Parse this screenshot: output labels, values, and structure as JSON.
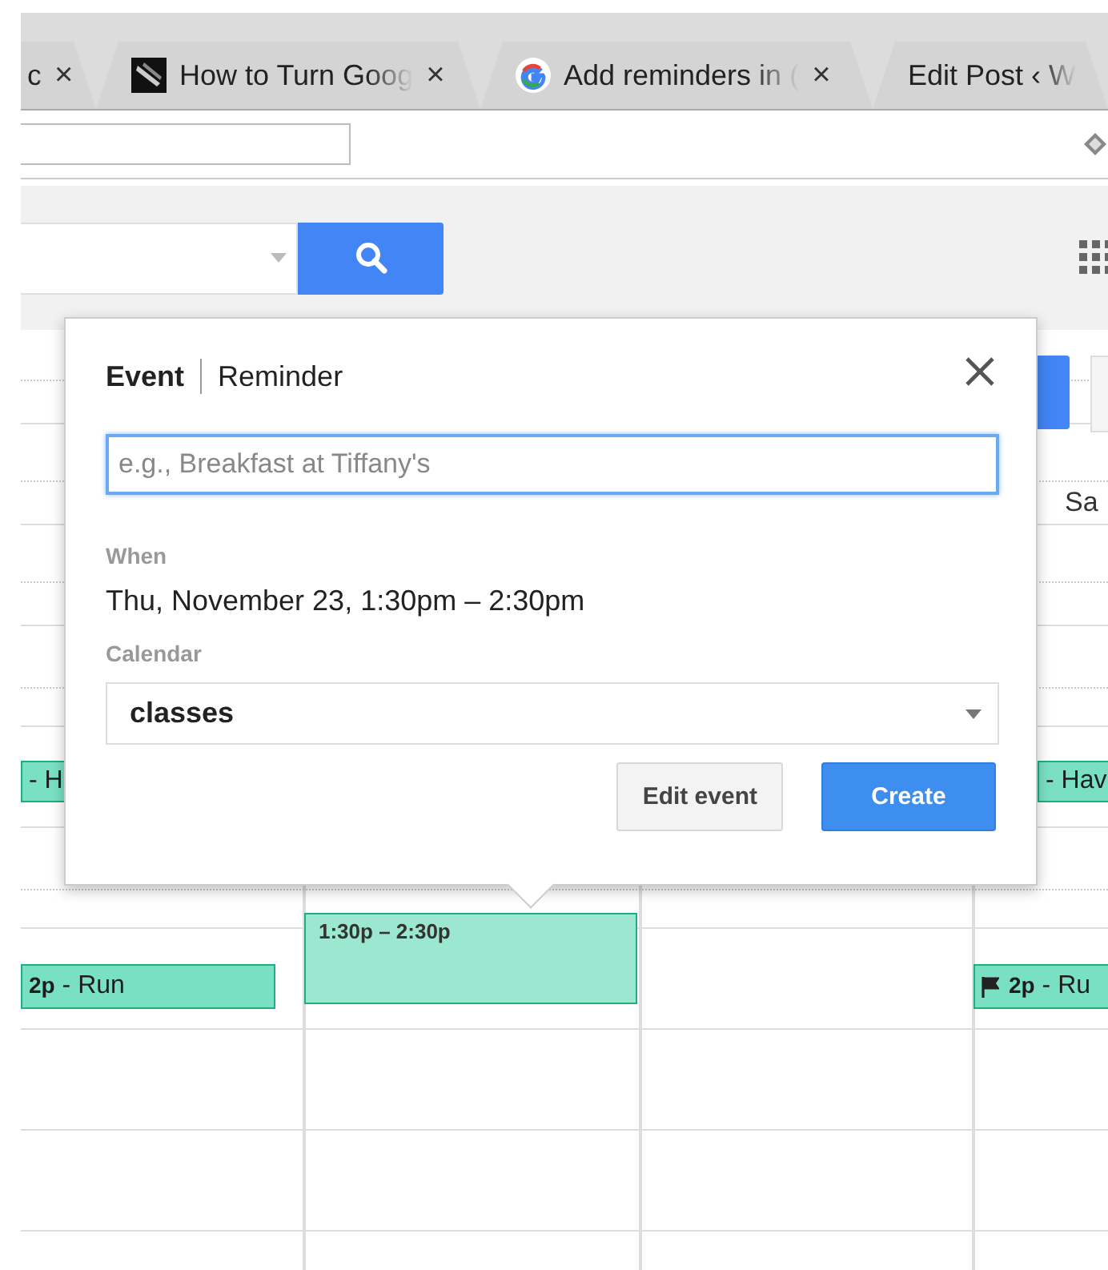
{
  "browser_tabs": [
    {
      "title": "c",
      "kind": "plain",
      "close": "×"
    },
    {
      "title": "How to Turn Goog",
      "kind": "image",
      "close": "×"
    },
    {
      "title": "Add reminders in (",
      "kind": "google",
      "close": "×"
    },
    {
      "title": "Edit Post ‹ W",
      "kind": "plain"
    }
  ],
  "calendar": {
    "day_header": "Sa",
    "events": [
      {
        "text": "- H",
        "flag": false
      },
      {
        "text": "- Hav",
        "flag": false
      },
      {
        "text": "**2p** - Run",
        "flag": false
      },
      {
        "text": "1:30p – 2:30p",
        "flag": false
      },
      {
        "text": "**2p** - Ru",
        "flag": true
      }
    ]
  },
  "popup": {
    "tabs": [
      {
        "label": "Event",
        "selected": true
      },
      {
        "label": "Reminder",
        "selected": false
      }
    ],
    "title_field": {
      "placeholder": "e.g., Breakfast at Tiffany's"
    },
    "when_label": "When",
    "when_value": "Thu, November 23, 1:30pm – 2:30pm",
    "calendar_label": "Calendar",
    "calendar_value": "classes",
    "buttons": [
      {
        "label": "Edit event",
        "kind": "secondary"
      },
      {
        "label": "Create",
        "kind": "primary"
      }
    ]
  }
}
